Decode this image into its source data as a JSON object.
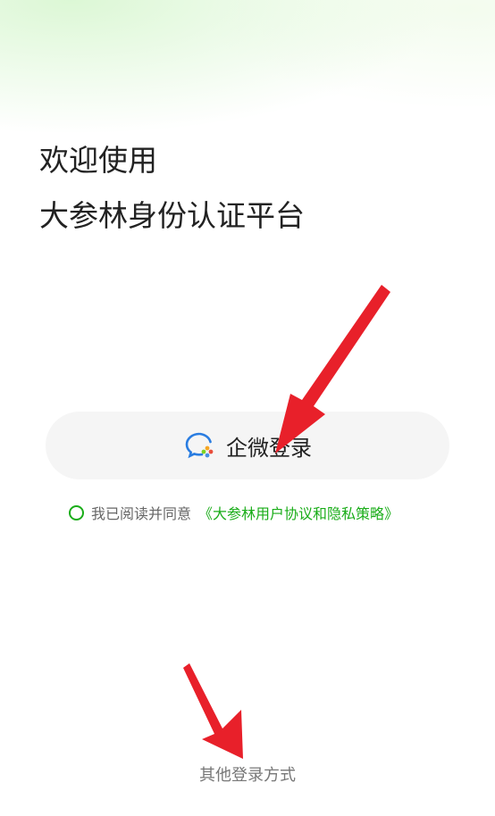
{
  "header": {
    "welcome_line": "欢迎使用",
    "platform_line": "大参林身份认证平台"
  },
  "login": {
    "wecom_button_label": "企微登录",
    "wecom_icon": "wecom-chat-icon"
  },
  "agreement": {
    "prefix": "我已阅读并同意",
    "link_text": "《大参林用户协议和隐私策略》",
    "checked": false
  },
  "footer": {
    "other_login_label": "其他登录方式"
  },
  "colors": {
    "accent": "#1aad19",
    "button_bg": "#f5f5f5",
    "annotation_arrow": "#e8202a"
  }
}
